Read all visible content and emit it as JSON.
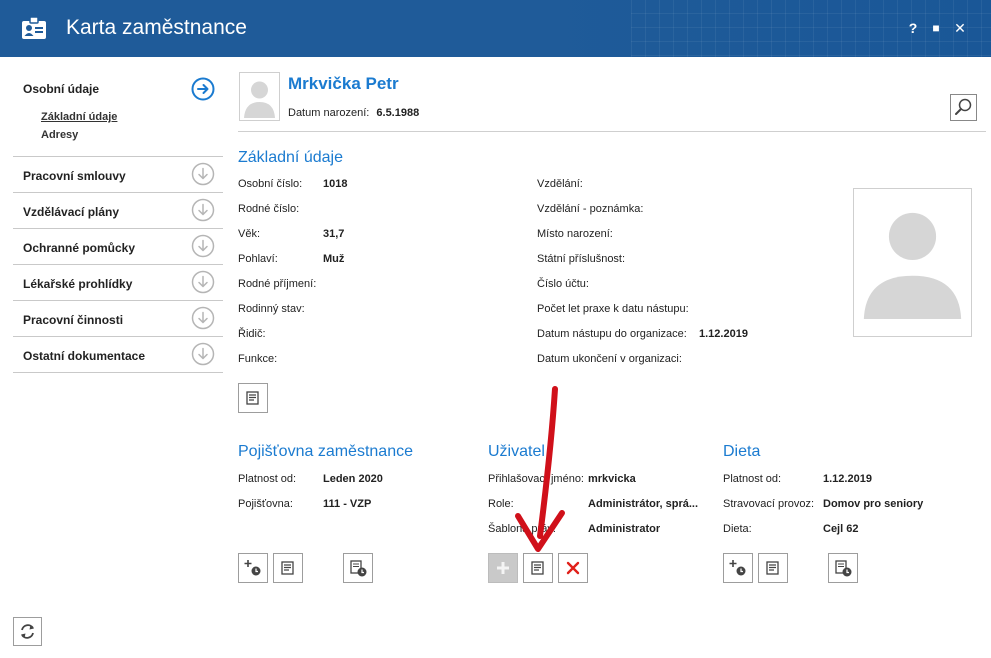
{
  "window": {
    "title": "Karta zaměstnance",
    "buttons": {
      "help": "?",
      "maximize": "■",
      "close": "✕"
    }
  },
  "nav": {
    "first": {
      "label": "Osobní údaje",
      "subitems": [
        "Základní údaje",
        "Adresy"
      ]
    },
    "items": [
      {
        "label": "Pracovní smlouvy"
      },
      {
        "label": "Vzdělávací plány"
      },
      {
        "label": "Ochranné pomůcky"
      },
      {
        "label": "Lékařské prohlídky"
      },
      {
        "label": "Pracovní činnosti"
      },
      {
        "label": "Ostatní dokumentace"
      }
    ]
  },
  "employee": {
    "name": "Mrkvička Petr",
    "dob_label": "Datum narození:",
    "dob_value": "6.5.1988"
  },
  "basic": {
    "title": "Základní údaje",
    "left": [
      {
        "label": "Osobní číslo:",
        "value": "1018"
      },
      {
        "label": "Rodné číslo:",
        "value": ""
      },
      {
        "label": "Věk:",
        "value": "31,7"
      },
      {
        "label": "Pohlaví:",
        "value": "Muž"
      },
      {
        "label": "Rodné příjmení:",
        "value": ""
      },
      {
        "label": "Rodinný stav:",
        "value": ""
      },
      {
        "label": "Řidič:",
        "value": ""
      },
      {
        "label": "Funkce:",
        "value": ""
      }
    ],
    "right": [
      {
        "label": "Vzdělání:",
        "value": ""
      },
      {
        "label": "Vzdělání - poznámka:",
        "value": ""
      },
      {
        "label": "Místo narození:",
        "value": ""
      },
      {
        "label": "Státní příslušnost:",
        "value": ""
      },
      {
        "label": "Číslo účtu:",
        "value": ""
      },
      {
        "label": "Počet let praxe k datu nástupu:",
        "value": ""
      },
      {
        "label": "Datum nástupu do organizace:",
        "value": "1.12.2019"
      },
      {
        "label": "Datum ukončení v organizaci:",
        "value": ""
      }
    ]
  },
  "insurance": {
    "title": "Pojišťovna zaměstnance",
    "rows": [
      {
        "label": "Platnost od:",
        "value": "Leden 2020"
      },
      {
        "label": "Pojišťovna:",
        "value": "111 - VZP"
      }
    ]
  },
  "user": {
    "title": "Uživatel",
    "rows": [
      {
        "label": "Přihlašovací jméno:",
        "value": "mrkvicka"
      },
      {
        "label": "Role:",
        "value": "Administrátor, sprá..."
      },
      {
        "label": "Šablona práv:",
        "value": "Administrator"
      }
    ]
  },
  "diet": {
    "title": "Dieta",
    "rows": [
      {
        "label": "Platnost od:",
        "value": "1.12.2019"
      },
      {
        "label": "Stravovací provoz:",
        "value": "Domov pro seniory"
      },
      {
        "label": "Dieta:",
        "value": "Cejl 62"
      }
    ]
  },
  "colors": {
    "titlebar": "#1f5b99",
    "accent": "#1b7bd0",
    "annotation": "#d0101a",
    "delete": "#e0201a"
  },
  "icons": {
    "edit": "edit-icon",
    "add_history": "add-history-icon",
    "history": "history-icon",
    "add": "plus-icon",
    "delete": "delete-icon",
    "search": "magnifier-icon",
    "refresh": "refresh-icon"
  }
}
